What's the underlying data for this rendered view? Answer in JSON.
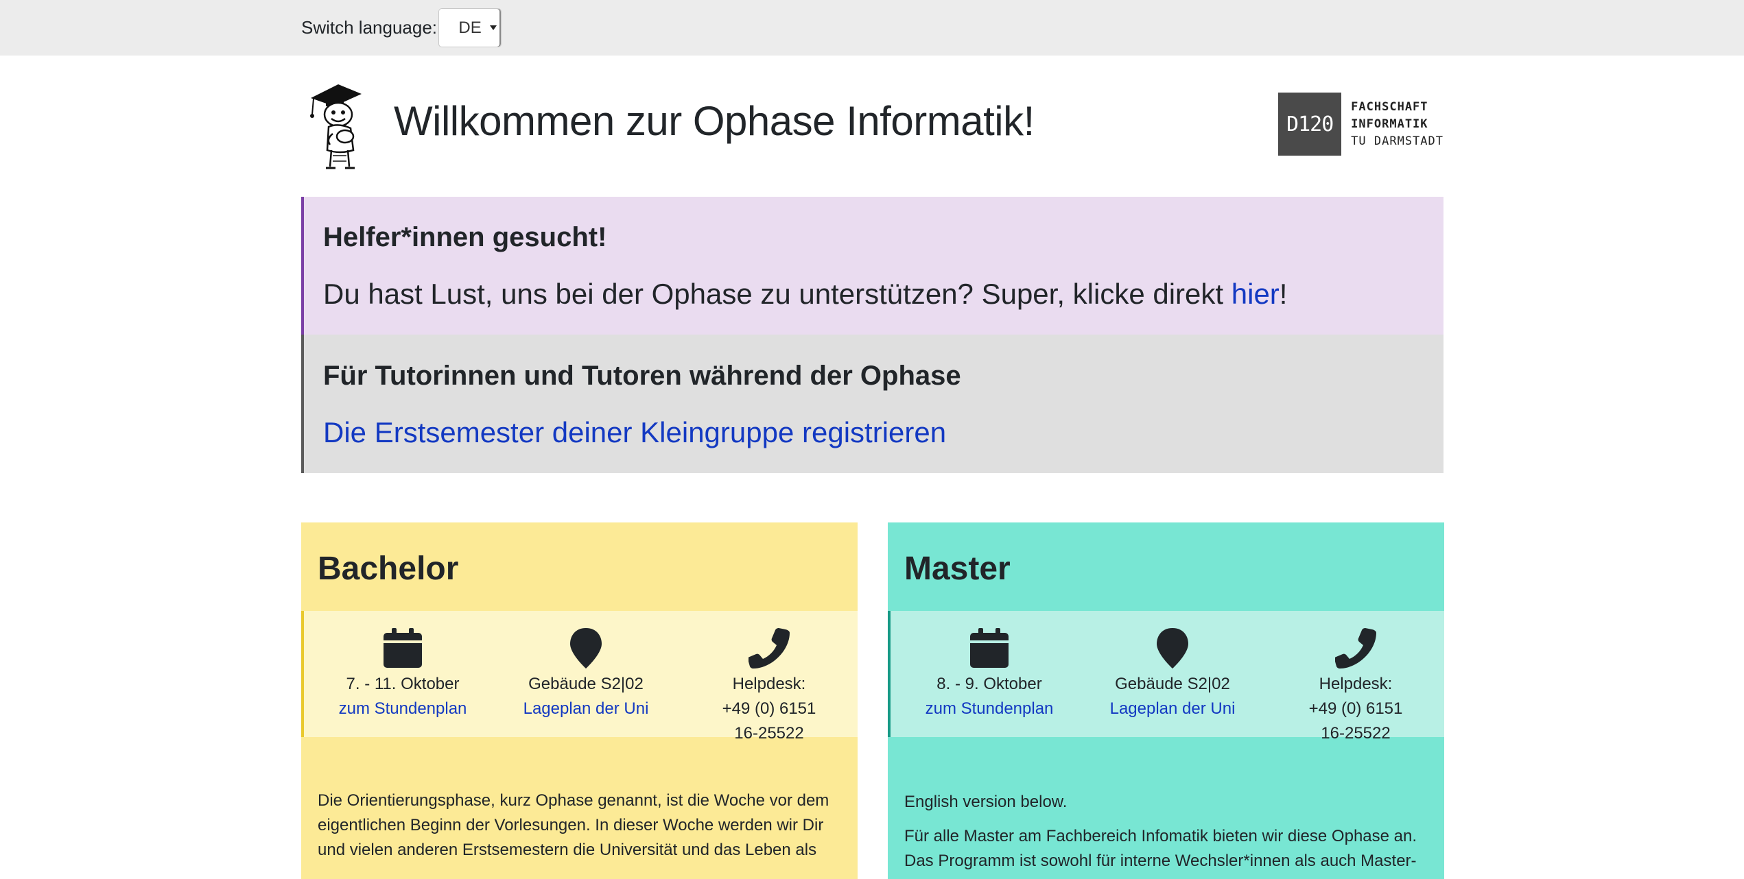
{
  "langbar": {
    "label": "Switch language:",
    "selected": "DE"
  },
  "header": {
    "title": "Willkommen zur Ophase Informatik!",
    "logo_box": "D120",
    "logo_line1": "FACHSCHAFT",
    "logo_line2": "INFORMATIK",
    "logo_line3": "TU DARMSTADT"
  },
  "helpers": {
    "title": "Helfer*innen gesucht!",
    "text_before": "Du hast Lust, uns bei der Ophase zu unterstützen? Super, klicke direkt ",
    "link": "hier",
    "text_after": "!"
  },
  "tutors": {
    "title": "Für Tutorinnen und Tutoren während der Ophase",
    "link": "Die Erstsemester deiner Kleingruppe registrieren"
  },
  "bachelor": {
    "title": "Bachelor",
    "date": "7. - 11. Oktober",
    "schedule_link": "zum Stundenplan",
    "location": "Gebäude S2|02",
    "map_link": "Lageplan der Uni",
    "helpdesk_label": "Helpdesk:",
    "phone_line1": "+49 (0) 6151",
    "phone_line2": "16-25522",
    "text": "Die Orientierungsphase, kurz Ophase genannt, ist die Woche vor dem eigentlichen Beginn der Vorlesungen. In dieser Woche werden wir Dir und vielen anderen Erstsemestern die Universität und das Leben als"
  },
  "master": {
    "title": "Master",
    "date": "8. - 9. Oktober",
    "schedule_link": "zum Stundenplan",
    "location": "Gebäude S2|02",
    "map_link": "Lageplan der Uni",
    "helpdesk_label": "Helpdesk:",
    "phone_line1": "+49 (0) 6151",
    "phone_line2": "16-25522",
    "text1": "English version below.",
    "text2": "Für alle Master am Fachbereich Infomatik bieten wir diese Ophase an. Das Programm ist sowohl für interne Wechsler*innen als auch Master-"
  },
  "icons": {
    "calendar": "calendar-icon",
    "location": "map-pin-icon",
    "phone": "phone-icon"
  },
  "colors": {
    "bachelor_bg": "#fcea96",
    "master_bg": "#78e6d3",
    "link": "#1339c2",
    "helpers_bg": "#eadcf0"
  }
}
